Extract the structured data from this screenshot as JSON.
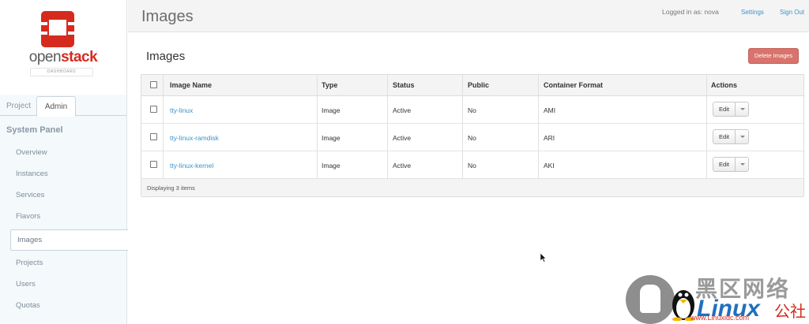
{
  "brand": {
    "name_part1": "open",
    "name_part2": "stack",
    "subtitle": "DASHBOARD",
    "accent_color": "#d52b1e"
  },
  "sidebar": {
    "tabs": [
      {
        "label": "Project",
        "active": false
      },
      {
        "label": "Admin",
        "active": true
      }
    ],
    "panel_title": "System Panel",
    "items": [
      {
        "label": "Overview",
        "active": false
      },
      {
        "label": "Instances",
        "active": false
      },
      {
        "label": "Services",
        "active": false
      },
      {
        "label": "Flavors",
        "active": false
      },
      {
        "label": "Images",
        "active": true
      },
      {
        "label": "Projects",
        "active": false
      },
      {
        "label": "Users",
        "active": false
      },
      {
        "label": "Quotas",
        "active": false
      }
    ]
  },
  "header": {
    "title": "Images",
    "logged_in": "Logged in as: nova",
    "settings_label": "Settings",
    "signout_label": "Sign Out"
  },
  "main": {
    "section_title": "Images",
    "delete_button": "Delete Images",
    "table": {
      "columns": [
        "Image Name",
        "Type",
        "Status",
        "Public",
        "Container Format",
        "Actions"
      ],
      "rows": [
        {
          "name": "tty-linux",
          "type": "Image",
          "status": "Active",
          "public": "No",
          "format": "AMI",
          "action": "Edit"
        },
        {
          "name": "tty-linux-ramdisk",
          "type": "Image",
          "status": "Active",
          "public": "No",
          "format": "ARI",
          "action": "Edit"
        },
        {
          "name": "tty-linux-kernel",
          "type": "Image",
          "status": "Active",
          "public": "No",
          "format": "AKI",
          "action": "Edit"
        }
      ],
      "footer": "Displaying 3 items"
    }
  },
  "watermark": {
    "cn_title": "黑区网络",
    "linux": "Linux",
    "she": "公社",
    "url": "www.Linuxidc.com"
  }
}
